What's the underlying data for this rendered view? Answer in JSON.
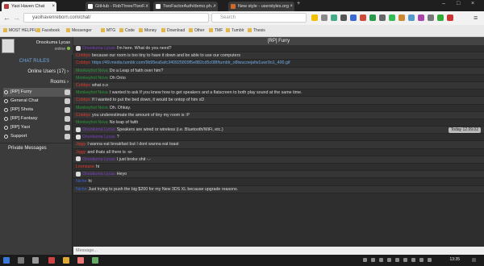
{
  "browser": {
    "tabs": [
      {
        "label": "Yaoi Haven Chat",
        "active": true,
        "color": "#b23b3b"
      },
      {
        "label": "GitHub - RobThree/TwoF...",
        "active": false,
        "color": "#ffffff"
      },
      {
        "label": "TwoFactorAuth/demo.ph...",
        "active": false,
        "color": "#ffffff"
      },
      {
        "label": "New style - userstyles.org",
        "active": false,
        "color": "#cf6a2a"
      }
    ],
    "url": "yaoihavenreborn.com/chat/",
    "search_placeholder": "Search",
    "bookmarks": [
      "MOST HELPFUL",
      "Facebook",
      "Messenger",
      "MTG",
      "Code",
      "Money",
      "Download",
      "Other",
      "TMF",
      "Tumblr",
      "Thesis"
    ]
  },
  "sidebar": {
    "username": "Onsokuma Lycas",
    "status": "online",
    "chat_rules": "CHAT RULES",
    "online_users": "Online Users (17)",
    "rooms_label": "Rooms",
    "rooms": [
      {
        "label": "[RP] Furry",
        "selected": true
      },
      {
        "label": "General Chat",
        "selected": false
      },
      {
        "label": "[RP] Shota",
        "selected": false
      },
      {
        "label": "[RP] Fantasy",
        "selected": false
      },
      {
        "label": "[RP] Yaoi",
        "selected": false
      },
      {
        "label": "Support",
        "selected": false
      }
    ],
    "private_messages": "Private Messages"
  },
  "chat": {
    "room_title": "[RP] Furry",
    "date_badge": "Today 12.09.02",
    "input_placeholder": "Message...",
    "messages": [
      {
        "name": "Onsokuma Lycas",
        "text": "I'm here. What do you need?",
        "color": "#7a3fc4",
        "icon": true
      },
      {
        "name": "Cobbys",
        "text": "because our room is too tiny to have it down and be able to use our computers",
        "color": "#e03a2a",
        "icon": false
      },
      {
        "name": "Cobbys",
        "text": "https://49.media.tumblr.com/9b95ea5afc340925809f5e882cd5c08f/tumblr_o8lwucoejafw1uwr9o1_400.gif",
        "color": "#e03a2a",
        "icon": false,
        "link": true
      },
      {
        "name": "Monkeyhot Nova",
        "text": "Do a Leap of faith over him?",
        "color": "#2b9b3a",
        "icon": false
      },
      {
        "name": "Monkeyhot Nova",
        "text": "Oh Onto",
        "color": "#2b9b3a",
        "icon": false
      },
      {
        "name": "Cobbys",
        "text": "what o.o",
        "color": "#e03a2a",
        "icon": false
      },
      {
        "name": "Monkeyhot Nova",
        "text": "I wanted to ask If you knew how to get speakers and a flatscreen to both play sound at the same time.",
        "color": "#2b9b3a",
        "icon": false
      },
      {
        "name": "Cobbys",
        "text": "If I wanted to put the bed down, it would be ontop of him xD",
        "color": "#e03a2a",
        "icon": false
      },
      {
        "name": "Monkeyhot Nova",
        "text": "Oh. Ohkay.",
        "color": "#2b9b3a",
        "icon": false
      },
      {
        "name": "Cobbys",
        "text": "you underestimate the amount of tiny my room is :P",
        "color": "#e03a2a",
        "icon": false
      },
      {
        "name": "Monkeyhot Nova",
        "text": "No leap of faith",
        "color": "#2b9b3a",
        "icon": false
      },
      {
        "name": "Onsokuma Lycas",
        "text": "Speakers are wired or wireless (i.e. Bluetooth/WiFi, etc.)",
        "color": "#7a3fc4",
        "icon": true,
        "badge": true
      },
      {
        "name": "Onsokuma Lycas",
        "text": "?",
        "color": "#7a3fc4",
        "icon": true
      },
      {
        "name": "Jiggy",
        "text": "I wanna eat breakfast but I dont wanna eat toast",
        "color": "#e03a2a",
        "icon": false
      },
      {
        "name": "Jiggy",
        "text": "and thats all there is -w-",
        "color": "#e03a2a",
        "icon": false
      },
      {
        "name": "Onsokuma Lycas",
        "text": "I just broke shit -.-",
        "color": "#7a3fc4",
        "icon": true
      },
      {
        "name": "Leonsaxe",
        "text": "hi",
        "color": "#e03a2a",
        "icon": false
      },
      {
        "name": "Onsokuma Lycas",
        "text": "Heyo",
        "color": "#7a3fc4",
        "icon": true
      },
      {
        "name": "Niche",
        "text": "hi",
        "color": "#3b63d6",
        "icon": false
      },
      {
        "name": "Niche",
        "text": "Just trying to push the big $200 for my New 3DS XL because upgrade reasons.",
        "color": "#3b63d6",
        "icon": false
      }
    ]
  },
  "taskbar": {
    "time": "13:35"
  }
}
